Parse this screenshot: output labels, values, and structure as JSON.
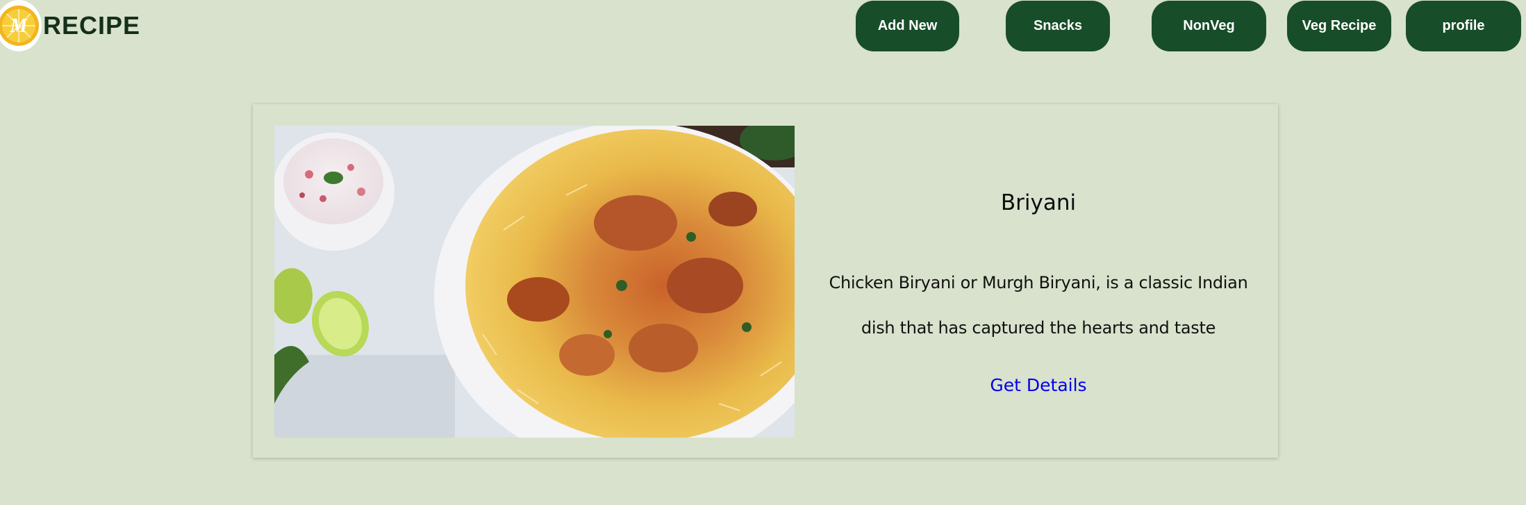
{
  "brand": {
    "name": "RECIPE",
    "logo_icon": "orange-slice-logo-icon",
    "logo_letter": "M"
  },
  "nav": {
    "add_new": "Add New",
    "snacks": "Snacks",
    "nonveg": "NonVeg",
    "veg_recipe": "Veg Recipe",
    "profile": "profile"
  },
  "recipe_card": {
    "title": "Briyani",
    "description": "Chicken Biryani or Murgh Biryani, is a classic Indian dish that has captured the hearts and taste",
    "link_label": "Get Details",
    "image_alt": "biryani-photo"
  },
  "colors": {
    "background": "#d8e2cc",
    "nav_button": "#184d29",
    "brand_text": "#15301a",
    "link": "#0000ee"
  }
}
